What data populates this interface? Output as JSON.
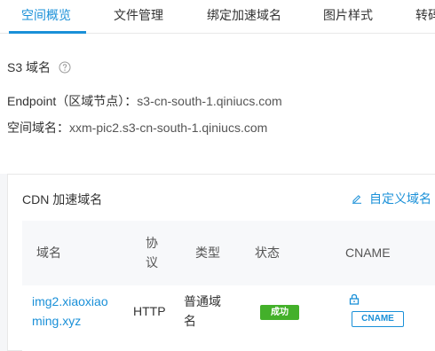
{
  "tabs": [
    {
      "label": "空间概览",
      "active": true
    },
    {
      "label": "文件管理",
      "active": false
    },
    {
      "label": "绑定加速域名",
      "active": false
    },
    {
      "label": "图片样式",
      "active": false
    },
    {
      "label": "转码",
      "active": false
    }
  ],
  "s3": {
    "title": "S3 域名",
    "help_icon": "question-circle-icon",
    "endpoint_label": "Endpoint（区域节点）：",
    "endpoint_value": "s3-cn-south-1.qiniucs.com",
    "space_domain_label": "空间域名：",
    "space_domain_value": "xxm-pic2.s3-cn-south-1.qiniucs.com"
  },
  "cdn": {
    "title": "CDN 加速域名",
    "custom_domain_label": "自定义域名",
    "custom_domain_icon": "edit-pencil-icon",
    "columns": {
      "domain": "域名",
      "protocol_line1": "协",
      "protocol_line2": "议",
      "type": "类型",
      "status": "状态",
      "cname": "CNAME"
    },
    "rows": [
      {
        "domain_line1": "img2.xiaoxiao",
        "domain_line2": "ming.xyz",
        "protocol": "HTTP",
        "type_line1": "普通域",
        "type_line2": "名",
        "status": "成功",
        "lock_icon": "lock-icon",
        "cname_button": "CNAME"
      }
    ]
  },
  "colors": {
    "accent": "#1a90d8",
    "success": "#43b02a"
  }
}
